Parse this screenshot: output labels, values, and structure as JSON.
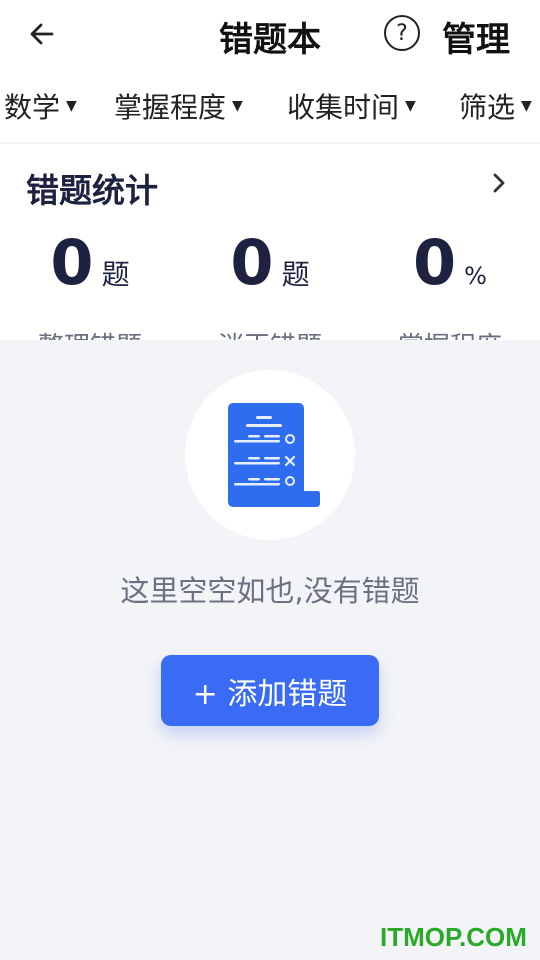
{
  "header": {
    "title": "错题本",
    "help_label": "?",
    "manage_label": "管理"
  },
  "filters": [
    {
      "label": "数学"
    },
    {
      "label": "掌握程度"
    },
    {
      "label": "收集时间"
    },
    {
      "label": "筛选"
    }
  ],
  "stats": {
    "title": "错题统计",
    "items": [
      {
        "value": "0",
        "unit": "题",
        "label": "整理错题"
      },
      {
        "value": "0",
        "unit": "题",
        "label": "消灭错题"
      },
      {
        "value": "0",
        "unit": "%",
        "label": "掌握程度"
      }
    ]
  },
  "empty": {
    "message": "这里空空如也,没有错题",
    "add_button": "+ 添加错题"
  },
  "watermark": "ITMOP.COM",
  "colors": {
    "accent": "#3a6bf5",
    "dark_text": "#1c2240",
    "page_bg": "#f3f4f7",
    "watermark": "#2aa928"
  }
}
